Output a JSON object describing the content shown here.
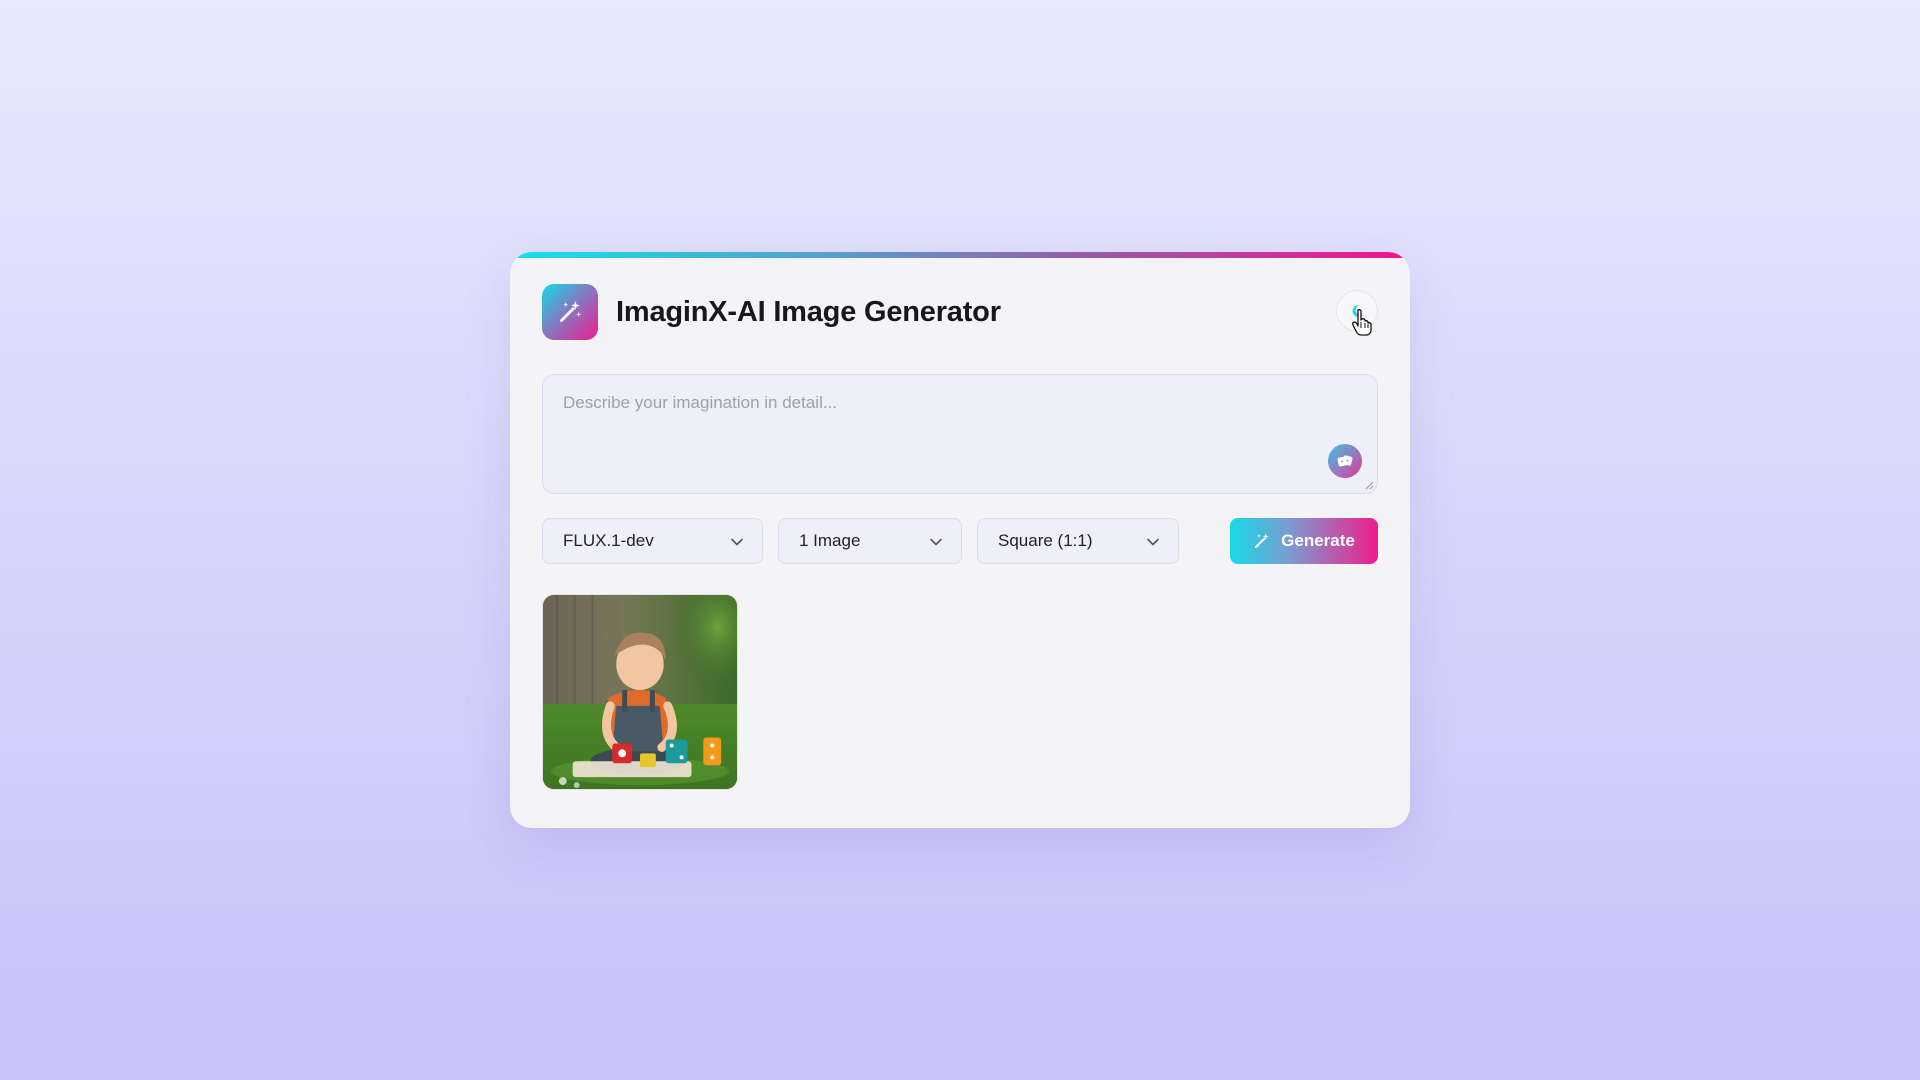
{
  "app": {
    "title": "ImaginX-AI Image Generator"
  },
  "prompt": {
    "value": "",
    "placeholder": "Describe your imagination in detail..."
  },
  "controls": {
    "model": {
      "selected": "FLUX.1-dev"
    },
    "count": {
      "selected": "1 Image"
    },
    "aspect_ratio": {
      "selected": "Square (1:1)"
    },
    "generate_label": "Generate"
  },
  "icons": {
    "logo": "magic-wand-icon",
    "theme_toggle": "moon-icon",
    "random_prompt": "dice-icon",
    "generate": "magic-wand-icon",
    "dropdown": "chevron-down-icon"
  },
  "gallery": {
    "images": [
      {
        "alt": "generated-image"
      }
    ]
  },
  "colors": {
    "accent_start": "#16e0ec",
    "accent_end": "#ee168f",
    "card_background": "#f4f4f6",
    "input_background": "#efeffa"
  }
}
